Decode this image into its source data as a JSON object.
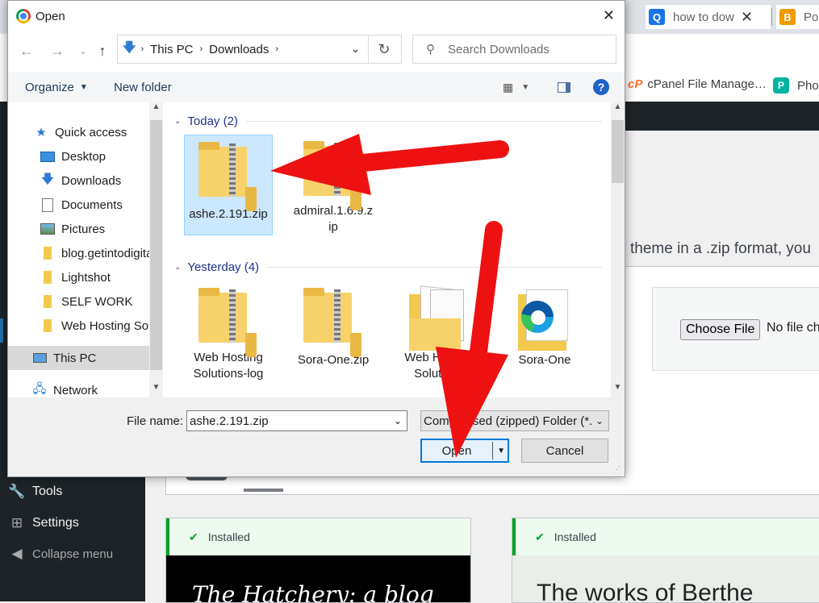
{
  "browser": {
    "tabs": [
      {
        "label": "how to dow",
        "favicon": "Q",
        "color": "#1a73e8"
      },
      {
        "label": "Po",
        "favicon": "B",
        "color": "#f29900"
      }
    ],
    "bookmarks": [
      {
        "label": "cPanel File Manage…",
        "icon": "cpanel-icon"
      },
      {
        "label": "Pho",
        "icon": "p-icon"
      }
    ]
  },
  "wordpress": {
    "menu": [
      {
        "label": "Tools",
        "icon": "wrench-icon"
      },
      {
        "label": "Settings",
        "icon": "settings-sliders-icon"
      },
      {
        "label": "Collapse menu",
        "icon": "collapse-icon"
      }
    ],
    "upload_text": "theme in a .zip format, you",
    "choose_file": "Choose File",
    "no_file": "No file ch",
    "cards": [
      {
        "status": "Installed",
        "preview": "The Hatchery: a blog"
      },
      {
        "status": "Installed",
        "preview": "The works of Berthe"
      }
    ]
  },
  "dialog": {
    "title": "Open",
    "close_glyph": "✕",
    "breadcrumb": [
      "This PC",
      "Downloads"
    ],
    "search_placeholder": "Search Downloads",
    "toolbar": {
      "organize": "Organize",
      "new_folder": "New folder"
    },
    "nav": [
      {
        "label": "Quick access",
        "icon": "star-icon",
        "indent": 0,
        "pinned": false
      },
      {
        "label": "Desktop",
        "icon": "desktop-icon",
        "indent": 1,
        "pinned": true
      },
      {
        "label": "Downloads",
        "icon": "download-icon",
        "indent": 1,
        "pinned": true
      },
      {
        "label": "Documents",
        "icon": "document-icon",
        "indent": 1,
        "pinned": true
      },
      {
        "label": "Pictures",
        "icon": "pictures-icon",
        "indent": 1,
        "pinned": true
      },
      {
        "label": "blog.getintodigita",
        "icon": "folder-icon",
        "indent": 1,
        "pinned": false
      },
      {
        "label": "Lightshot",
        "icon": "folder-icon",
        "indent": 1,
        "pinned": false
      },
      {
        "label": "SELF WORK",
        "icon": "folder-icon",
        "indent": 1,
        "pinned": false
      },
      {
        "label": "Web Hosting Solu",
        "icon": "folder-icon",
        "indent": 1,
        "pinned": false
      },
      {
        "label": "This PC",
        "icon": "computer-icon",
        "indent": 0,
        "pinned": false,
        "selected": true
      },
      {
        "label": "Network",
        "icon": "network-icon",
        "indent": 0,
        "pinned": false
      }
    ],
    "groups": [
      {
        "label": "Today (2)",
        "files": [
          {
            "name": "ashe.2.191.zip",
            "type": "zip",
            "selected": true
          },
          {
            "name": "admiral.1.6.9.zip",
            "type": "zip",
            "selected": false
          }
        ]
      },
      {
        "label": "Yesterday (4)",
        "files": [
          {
            "name": "Web Hosting Solutions-log",
            "type": "zip",
            "selected": false
          },
          {
            "name": "Sora-One.zip",
            "type": "zip",
            "selected": false
          },
          {
            "name": "Web Hosting Solutions",
            "type": "folder-docs",
            "selected": false
          },
          {
            "name": "Sora-One",
            "type": "folder-edge",
            "selected": false
          }
        ]
      }
    ],
    "file_name_label": "File name:",
    "file_name_value": "ashe.2.191.zip",
    "file_type": "Compressed (zipped) Folder (*.",
    "open_button": "Open",
    "cancel_button": "Cancel"
  },
  "colors": {
    "annotation_arrow": "#ee1111",
    "accent": "#0078d7",
    "selection": "#cce8ff"
  }
}
